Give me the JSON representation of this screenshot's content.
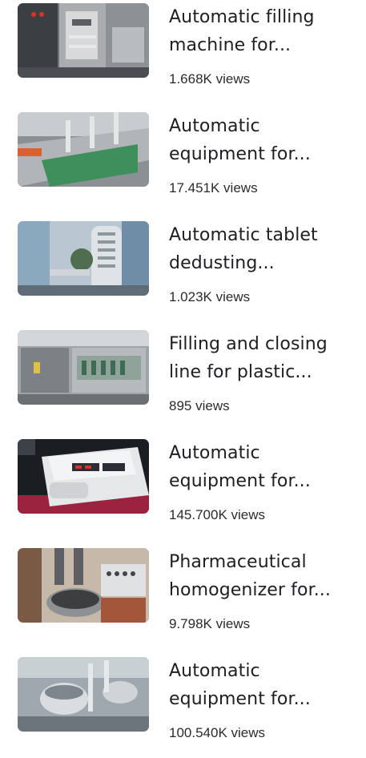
{
  "videos": [
    {
      "title": "Automatic filling\nmachine for...",
      "views": "1.668K views",
      "thumb_icon": "vertical-packaging-machine-image"
    },
    {
      "title": "Automatic\nequipment for...",
      "views": "17.451K views",
      "thumb_icon": "conveyor-line-machine-image"
    },
    {
      "title": "Automatic tablet\ndedusting...",
      "views": "1.023K views",
      "thumb_icon": "tablet-deduster-image"
    },
    {
      "title": "Filling and closing\nline for plastic...",
      "views": "895 views",
      "thumb_icon": "filling-line-machine-image"
    },
    {
      "title": "Automatic\nequipment for...",
      "views": "145.700K views",
      "thumb_icon": "tablet-tester-image"
    },
    {
      "title": "Pharmaceutical\nhomogenizer for...",
      "views": "9.798K views",
      "thumb_icon": "homogenizer-image"
    },
    {
      "title": "Automatic\nequipment for...",
      "views": "100.540K views",
      "thumb_icon": "steel-vessel-machine-image"
    }
  ]
}
